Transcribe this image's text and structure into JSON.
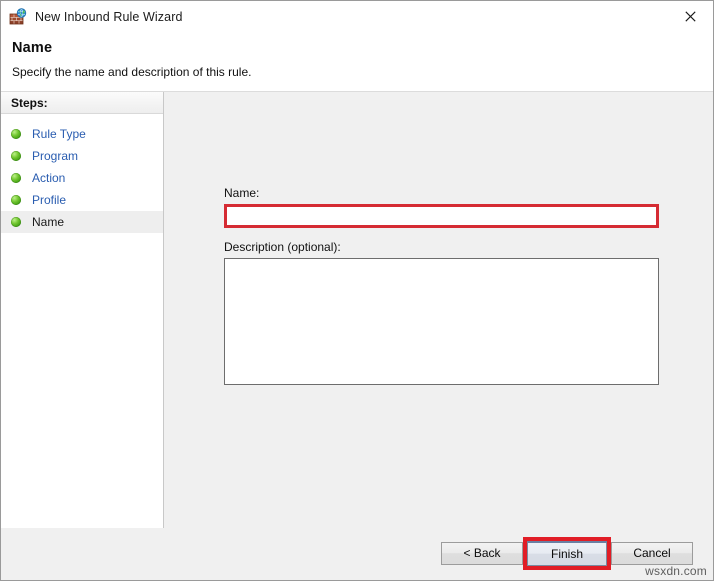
{
  "window": {
    "title": "New Inbound Rule Wizard",
    "icon": "firewall-globe-icon",
    "close_label": "✕"
  },
  "header": {
    "title": "Name",
    "subtitle": "Specify the name and description of this rule."
  },
  "sidebar": {
    "heading": "Steps:",
    "items": [
      {
        "label": "Rule Type",
        "state": "completed",
        "bullet": "green-sphere-icon"
      },
      {
        "label": "Program",
        "state": "completed",
        "bullet": "green-sphere-icon"
      },
      {
        "label": "Action",
        "state": "completed",
        "bullet": "green-sphere-icon"
      },
      {
        "label": "Profile",
        "state": "completed",
        "bullet": "green-sphere-icon"
      },
      {
        "label": "Name",
        "state": "current",
        "bullet": "green-sphere-icon"
      }
    ]
  },
  "form": {
    "name_label": "Name:",
    "name_value": "",
    "name_placeholder": "",
    "description_label": "Description (optional):",
    "description_value": "",
    "description_placeholder": ""
  },
  "footer": {
    "back_label": "< Back",
    "finish_label": "Finish",
    "cancel_label": "Cancel"
  },
  "annotations": {
    "highlight_color": "#d52b33",
    "finish_highlight_color": "#e11d26"
  },
  "watermark": {
    "text": "wsxdn.com"
  },
  "colors": {
    "content_background": "#f0f0f0",
    "sidebar_background": "#ffffff",
    "link_blue": "#2a5db0",
    "title_text": "#1b1b1b"
  }
}
